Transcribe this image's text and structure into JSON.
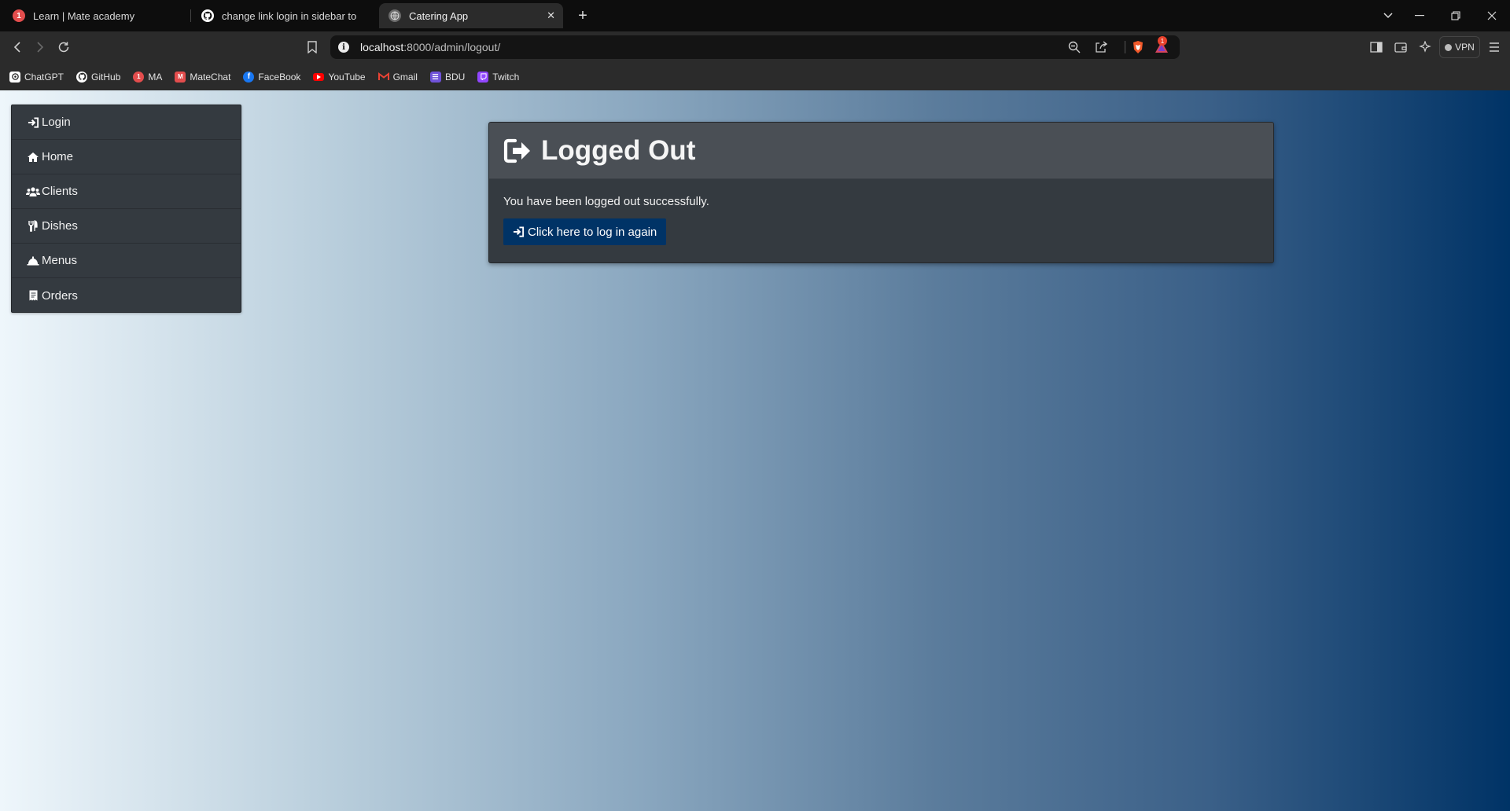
{
  "browser": {
    "tabs": [
      {
        "title": "Learn | Mate academy",
        "badge": "1",
        "active": false
      },
      {
        "title": "change link login in sidebar to avoid",
        "active": false
      },
      {
        "title": "Catering App",
        "active": true
      }
    ],
    "url_host": "localhost",
    "url_rest": ":8000/admin/logout/",
    "brave_badge": "1",
    "vpn_label": "VPN",
    "bookmarks": [
      {
        "label": "ChatGPT",
        "icon": "chatgpt-icon",
        "color": "#ffffff"
      },
      {
        "label": "GitHub",
        "icon": "github-icon",
        "color": "#ffffff"
      },
      {
        "label": "MA",
        "icon": "mate-academy-icon",
        "color": "#e34d4d"
      },
      {
        "label": "MateChat",
        "icon": "matechat-icon",
        "color": "#e34d4d"
      },
      {
        "label": "FaceBook",
        "icon": "facebook-icon",
        "color": "#1877f2"
      },
      {
        "label": "YouTube",
        "icon": "youtube-icon",
        "color": "#ff0000"
      },
      {
        "label": "Gmail",
        "icon": "gmail-icon",
        "color": "#ea4335"
      },
      {
        "label": "BDU",
        "icon": "bdu-icon",
        "color": "#6f52d9"
      },
      {
        "label": "Twitch",
        "icon": "twitch-icon",
        "color": "#9146ff"
      }
    ]
  },
  "sidebar": {
    "items": [
      {
        "label": "Login",
        "icon": "sign-in-icon"
      },
      {
        "label": "Home",
        "icon": "home-icon"
      },
      {
        "label": "Clients",
        "icon": "users-icon"
      },
      {
        "label": "Dishes",
        "icon": "utensils-icon"
      },
      {
        "label": "Menus",
        "icon": "cloche-icon"
      },
      {
        "label": "Orders",
        "icon": "receipt-icon"
      }
    ]
  },
  "card": {
    "title": "Logged Out",
    "message": "You have been logged out successfully.",
    "button_label": "Click here to log in again"
  },
  "colors": {
    "sidebar_bg": "#343a40",
    "card_header_bg": "#4a4f55",
    "button_bg": "#003366",
    "gradient_start": "#eef6fb",
    "gradient_end": "#003366"
  }
}
